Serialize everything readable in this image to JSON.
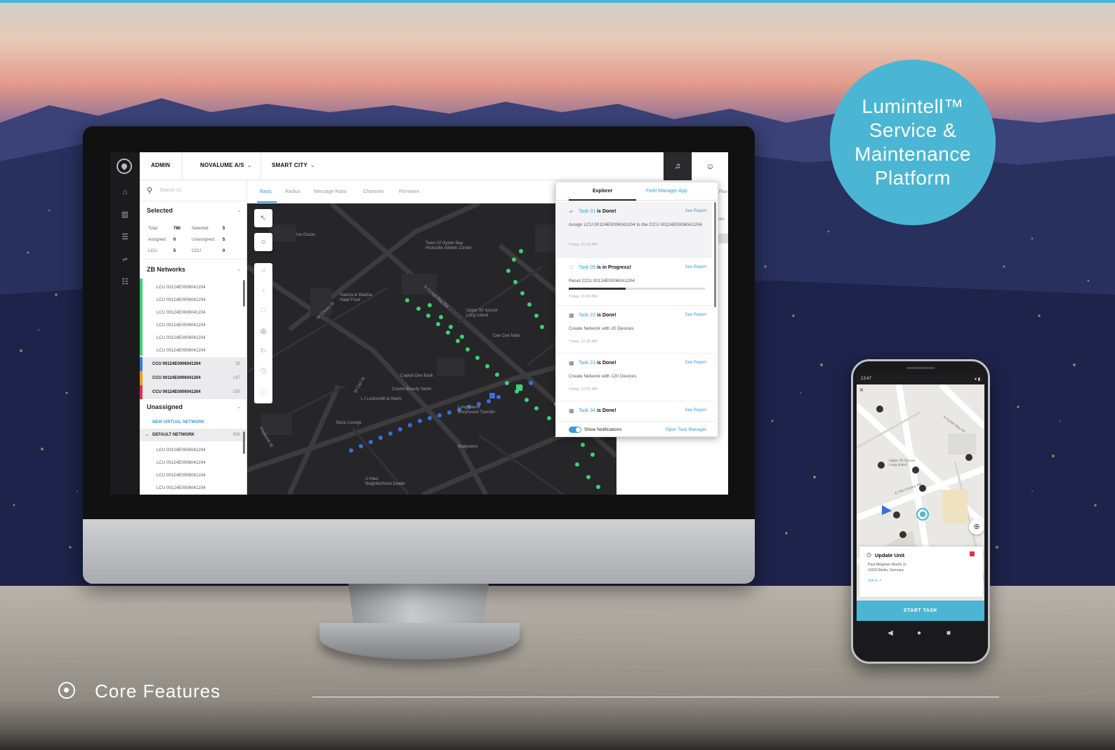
{
  "badge": {
    "line1": "Lumintell™",
    "line2": "Service &",
    "line3": "Maintenance",
    "line4": "Platform"
  },
  "colors": {
    "accent": "#4bb6d3",
    "link": "#3a9bd9",
    "green": "#3fcf73",
    "map_bg": "#262628"
  },
  "dashboard": {
    "topbar": {
      "crumb1": "ADMIN",
      "crumb2": "NOVALUME A/S",
      "crumb3": "SMART CITY",
      "chevron": "⌄"
    },
    "search": {
      "placeholder": "Search ID"
    },
    "selected": {
      "title": "Selected",
      "total_label": "Total:",
      "total_value": "780",
      "selected_label": "Selected:",
      "selected_value": "5",
      "assigned_label": "Assigned:",
      "assigned_value": "0",
      "unassigned_label": "Unassigned:",
      "unassigned_value": "5",
      "lcu_label": "LCU:",
      "lcu_value": "5",
      "ccu_label": "CCU:",
      "ccu_value": "0"
    },
    "zb": {
      "title": "ZB Networks",
      "lcus": [
        "LCU 00124E0006041204",
        "LCU 00124E0006041204",
        "LCU 00124E0006041204",
        "LCU 00124E0006041204",
        "LCU 00124E0006041204",
        "LCU 00124E0006041204"
      ],
      "ccus": [
        {
          "label": "CCU 00124E0006041204",
          "count": "35",
          "color": "#3a7bd9"
        },
        {
          "label": "CCU 00124E0006041204",
          "count": "147",
          "color": "#f29a1f"
        },
        {
          "label": "CCU 00124E0006041204",
          "count": "150",
          "color": "#e0324a"
        }
      ]
    },
    "unassigned": {
      "title": "Unassigned",
      "new_network": "NEW VIRTUAL NETWORK",
      "default_network": "DEFAULT NETWORK",
      "default_count": "500",
      "lcus": [
        "LCU 00124E0006041204",
        "LCU 00124E0006041204",
        "LCU 00124E0006041204",
        "LCU 00124E0006041204"
      ]
    },
    "tabs": [
      "Basic",
      "Radius",
      "Message Ratio",
      "Channels",
      "Firmware"
    ],
    "right_panel": {
      "plan": "ent Plan",
      "tasks": "tasks"
    },
    "map_pois": {
      "poi1": "nia Ouzas",
      "poi2": "Town Of Oyster Bay\nHicksville Athletic Center",
      "poi3": "Hamza & Madina\nHalal Food",
      "poi4": "Upper 90 Soccer\nLong Island",
      "poi5": "Cee Cee Nails",
      "poi6": "Capital One Bank",
      "poi7": "Cosmo Beauty Salon",
      "poi8": "L I Locksmith & Alarm",
      "poi9": "Long Island\nGreyhound Transfer",
      "poi10": "Spice Lounge",
      "poi11": "Walgreens",
      "poi12": "U-Haul\nNeighborhood Dealer",
      "st1": "W Cherry St",
      "st2": "W Carl St",
      "st3": "S Oyster Bay Rd",
      "st4": "Frederick St"
    },
    "notifications": {
      "tab_explorer": "Explorer",
      "tab_field": "Field Manager App",
      "see_report": "See Report",
      "items": [
        {
          "task": "Task 01",
          "status": " is Done!",
          "body": "Assign LCU 00124E0006041204 to the CCU 00124E00060A1204",
          "time": "Today, 01:10 PM"
        },
        {
          "task": "Task 09",
          "status": " is in Progress!",
          "body": "Reset CCU 00124E00060A1204",
          "time": "Today, 01:03 PM"
        },
        {
          "task": "Task 22",
          "status": " is Done!",
          "body": "Create Network with 20 Devices",
          "time": "Today, 12:30 AM"
        },
        {
          "task": "Task 23",
          "status": " is Done!",
          "body": "Create Network with 120 Devices",
          "time": "Today, 12:02 AM"
        },
        {
          "task": "Task 34",
          "status": " is Done!",
          "body": "",
          "time": ""
        }
      ],
      "progress": 0.42,
      "show_notifications": "Show Notifications",
      "open_task_manager": "Open Task Manager"
    }
  },
  "phone": {
    "status_time": "13:47",
    "card_title": "Update Unit",
    "address_line1": "Paul-Wegener-Straße 11",
    "address_line2": "12623 Berlin, Germany",
    "distance": "124 m ↗",
    "start_button": "START TASK",
    "street1": "S Oyster Bay Rd",
    "street2": "Upper 90 Soccer\nLong Island",
    "street3": "E Old Country Rd"
  },
  "footer": {
    "label": "Core Features"
  }
}
